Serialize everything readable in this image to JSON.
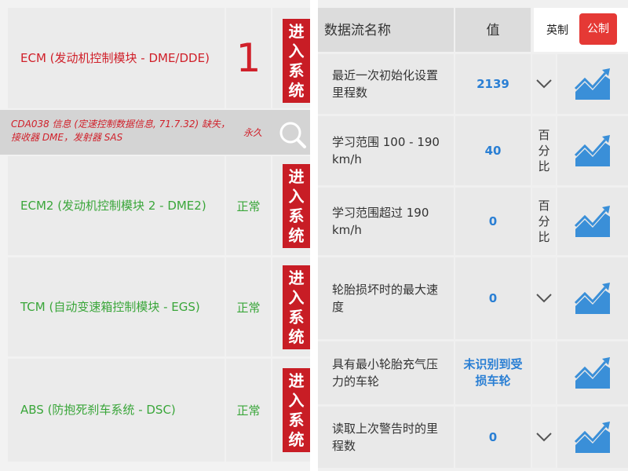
{
  "modules": [
    {
      "name": "ECM (发动机控制模块 - DME/DDE)",
      "status": "1",
      "enter_label": [
        "进",
        "入",
        "系",
        "统"
      ]
    },
    {
      "name": "ECM2 (发动机控制模块 2 - DME2)",
      "status": "正常",
      "enter_label": [
        "进",
        "入",
        "系",
        "统"
      ]
    },
    {
      "name": "TCM (自动变速箱控制模块 - EGS)",
      "status": "正常",
      "enter_label": [
        "进",
        "入",
        "系",
        "统"
      ]
    },
    {
      "name": "ABS (防抱死刹车系统 - DSC)",
      "status": "正常",
      "enter_label": [
        "进",
        "入",
        "系",
        "统"
      ]
    }
  ],
  "fault": {
    "text": "CDA038 信息 (定速控制数据信息, 71.7.32) 缺失，接收器 DME，发射器 SAS",
    "status": "永久",
    "icon": "search-icon"
  },
  "datastream": {
    "header": {
      "name": "数据流名称",
      "value": "值"
    },
    "unit_toggle": {
      "imperial": "英制",
      "metric": "公制",
      "active": "metric"
    },
    "rows": [
      {
        "name": "最近一次初始化设置里程数",
        "value": "2139",
        "unit": "",
        "chevron": true
      },
      {
        "name": "学习范围 100 - 190 km/h",
        "value": "40",
        "unit": "百分比",
        "chevron": false
      },
      {
        "name": "学习范围超过 190 km/h",
        "value": "0",
        "unit": "百分比",
        "chevron": false
      },
      {
        "name": "轮胎损坏时的最大速度",
        "value": "0",
        "unit": "",
        "chevron": true
      },
      {
        "name": "具有最小轮胎充气压力的车轮",
        "value": "未识别到受损车轮",
        "unit": "",
        "chevron": false
      },
      {
        "name": "读取上次警告时的里程数",
        "value": "0",
        "unit": "",
        "chevron": true
      }
    ]
  },
  "colors": {
    "accent_red": "#c81d25",
    "ok_green": "#3aa63a",
    "value_blue": "#2a7fd4",
    "graph_blue": "#3a8fd8"
  }
}
